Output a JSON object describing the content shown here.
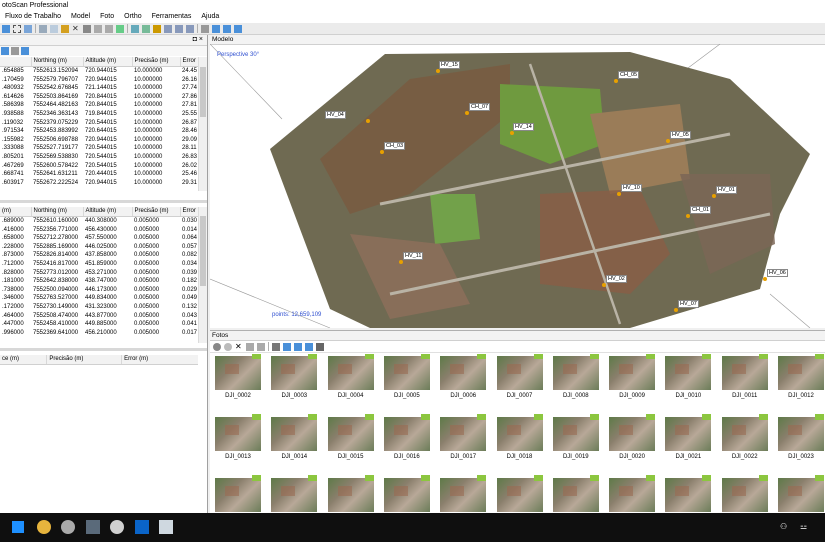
{
  "app": {
    "title": "otoScan Professional",
    "menu": [
      "Fluxo de Trabalho",
      "Model",
      "Foto",
      "Ortho",
      "Ferramentas",
      "Ajuda"
    ]
  },
  "left_panel": {
    "controls": "◘ ×",
    "cameras": {
      "headers": [
        "",
        "Northing (m)",
        "Altitude (m)",
        "Precisão (m)",
        "Error"
      ],
      "rows": [
        [
          ".654885",
          "7552613.152094",
          "720.944015",
          "10.000000",
          "24.45"
        ],
        [
          ".170459",
          "7552579.796707",
          "720.944015",
          "10.000000",
          "26.16"
        ],
        [
          ".480932",
          "7552542.676845",
          "721.144015",
          "10.000000",
          "27.74"
        ],
        [
          ".614626",
          "7552503.864169",
          "720.844015",
          "10.000000",
          "27.86"
        ],
        [
          ".586398",
          "7552464.482163",
          "720.844015",
          "10.000000",
          "27.81"
        ],
        [
          ".938588",
          "7552346.363143",
          "719.844015",
          "10.000000",
          "25.55"
        ],
        [
          ".119032",
          "7552379.075229",
          "720.544015",
          "10.000000",
          "26.87"
        ],
        [
          ".971534",
          "7552453.883992",
          "720.644015",
          "10.000000",
          "28.46"
        ],
        [
          ".155982",
          "7552506.698788",
          "720.944015",
          "10.000000",
          "29.09"
        ],
        [
          ".333088",
          "7552527.719177",
          "720.544015",
          "10.000000",
          "28.11"
        ],
        [
          ".805201",
          "7552569.538830",
          "720.544015",
          "10.000000",
          "26.83"
        ],
        [
          ".467269",
          "7552600.578422",
          "720.544015",
          "10.000000",
          "26.02"
        ],
        [
          ".668741",
          "7552641.631211",
          "720.444015",
          "10.000000",
          "25.46"
        ],
        [
          ".603917",
          "7552672.222524",
          "720.944015",
          "10.000000",
          "29.31"
        ]
      ]
    },
    "markers": {
      "headers": [
        "(m)",
        "Northing (m)",
        "Altitude (m)",
        "Precisão (m)",
        "Error"
      ],
      "rows": [
        [
          ".689000",
          "7552610.160000",
          "440.308000",
          "0.005000",
          "0.030"
        ],
        [
          ".416000",
          "7552356.771000",
          "456.430000",
          "0.005000",
          "0.014"
        ],
        [
          ".658000",
          "7552712.278000",
          "457.550000",
          "0.005000",
          "0.064"
        ],
        [
          ".228000",
          "7552885.169000",
          "446.025000",
          "0.005000",
          "0.057"
        ],
        [
          ".873000",
          "7552826.814000",
          "437.858000",
          "0.005000",
          "0.082"
        ],
        [
          ".712000",
          "7552416.817000",
          "451.859000",
          "0.005000",
          "0.034"
        ],
        [
          ".828000",
          "7552773.012000",
          "453.271000",
          "0.005000",
          "0.039"
        ],
        [
          ".181000",
          "7552642.838000",
          "438.747000",
          "0.005000",
          "0.182"
        ],
        [
          ".738000",
          "7552500.094000",
          "446.173000",
          "0.005000",
          "0.029"
        ],
        [
          ".346000",
          "7552763.527000",
          "449.834000",
          "0.005000",
          "0.049"
        ],
        [
          ".172000",
          "7552730.149000",
          "431.323000",
          "0.005000",
          "0.132"
        ],
        [
          ".464000",
          "7552508.474000",
          "443.877000",
          "0.005000",
          "0.043"
        ],
        [
          ".447000",
          "7552458.410000",
          "449.885000",
          "0.005000",
          "0.041"
        ],
        [
          ".996000",
          "7552369.641000",
          "456.210000",
          "0.005000",
          "0.017"
        ]
      ]
    },
    "scale": {
      "headers": [
        "ce (m)",
        "Precisão (m)",
        "Error (m)"
      ]
    }
  },
  "model": {
    "title": "Modelo",
    "perspective": "Perspective 30°",
    "points": "points: 12,659,109",
    "markers": [
      {
        "label": "HV_15"
      },
      {
        "label": "CH_05"
      },
      {
        "label": "CH_07"
      },
      {
        "label": "HV_04"
      },
      {
        "label": "HV_14"
      },
      {
        "label": "CH_03"
      },
      {
        "label": "HV_05"
      },
      {
        "label": "HV_10"
      },
      {
        "label": "HV_01"
      },
      {
        "label": "CH_01"
      },
      {
        "label": "HV_11"
      },
      {
        "label": "HV_02"
      },
      {
        "label": "HV_06"
      },
      {
        "label": "HV_07"
      }
    ]
  },
  "photos": {
    "title": "Fotos",
    "captions": [
      "DJI_0002",
      "DJI_0003",
      "DJI_0004",
      "DJI_0005",
      "DJI_0006",
      "DJI_0007",
      "DJI_0008",
      "DJI_0009",
      "DJI_0010",
      "DJI_0011",
      "DJI_0012",
      "DJI_0013",
      "DJI_0014",
      "DJI_0015",
      "DJI_0016",
      "DJI_0017",
      "DJI_0018",
      "DJI_0019",
      "DJI_0020",
      "DJI_0021",
      "DJI_0022",
      "DJI_0023",
      "",
      "",
      "",
      "",
      "",
      "",
      "",
      "",
      "",
      "",
      ""
    ]
  },
  "colors": {
    "accent": "#3050d0",
    "marker": "#e8a000",
    "ok": "#8cc63f",
    "taskbar": "#0f0f0f"
  }
}
